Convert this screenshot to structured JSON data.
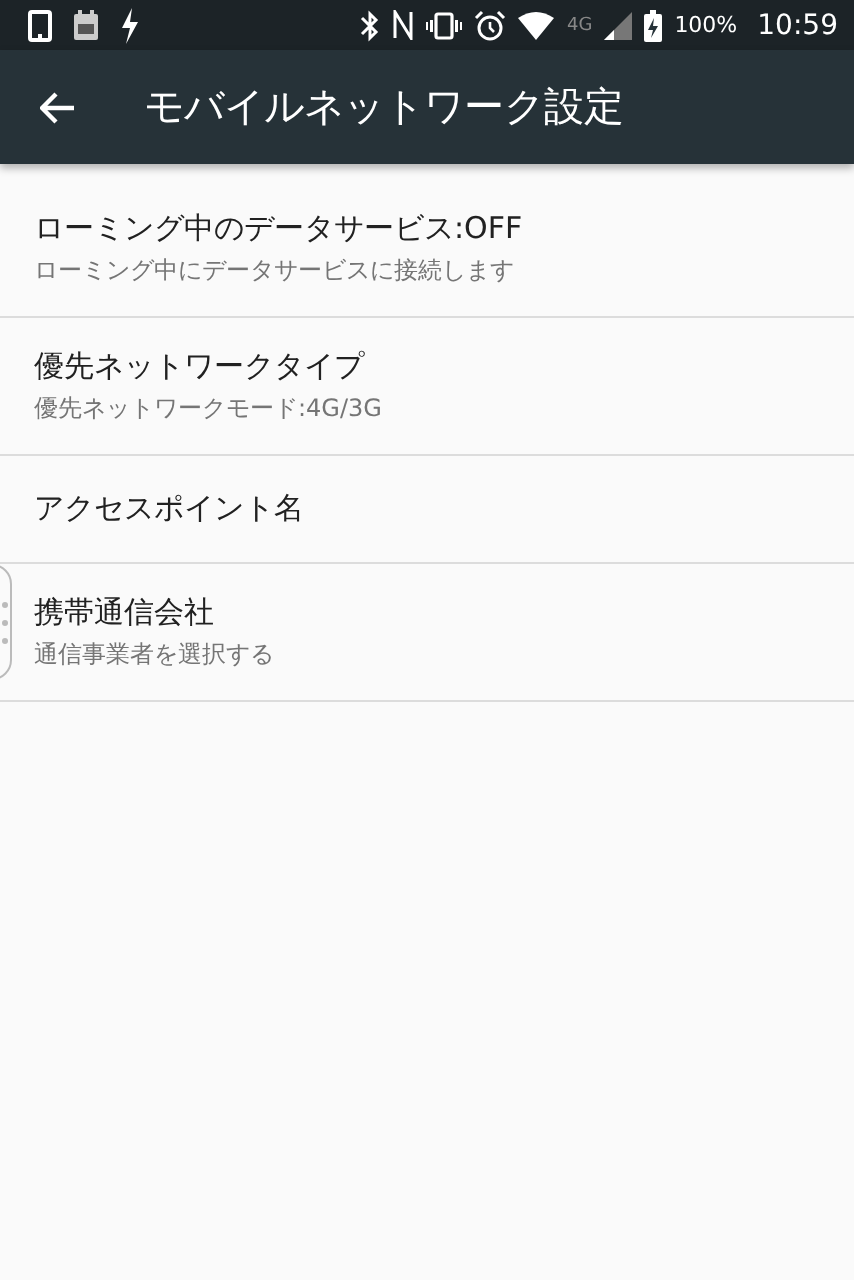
{
  "status_bar": {
    "network_type": "4G",
    "battery": "100%",
    "time": "10:59"
  },
  "app_bar": {
    "title": "モバイルネットワーク設定"
  },
  "settings": [
    {
      "title": "ローミング中のデータサービス:OFF",
      "summary": "ローミング中にデータサービスに接続します"
    },
    {
      "title": "優先ネットワークタイプ",
      "summary": "優先ネットワークモード:4G/3G"
    },
    {
      "title": "アクセスポイント名"
    },
    {
      "title": "携帯通信会社",
      "summary": "通信事業者を選択する"
    }
  ]
}
